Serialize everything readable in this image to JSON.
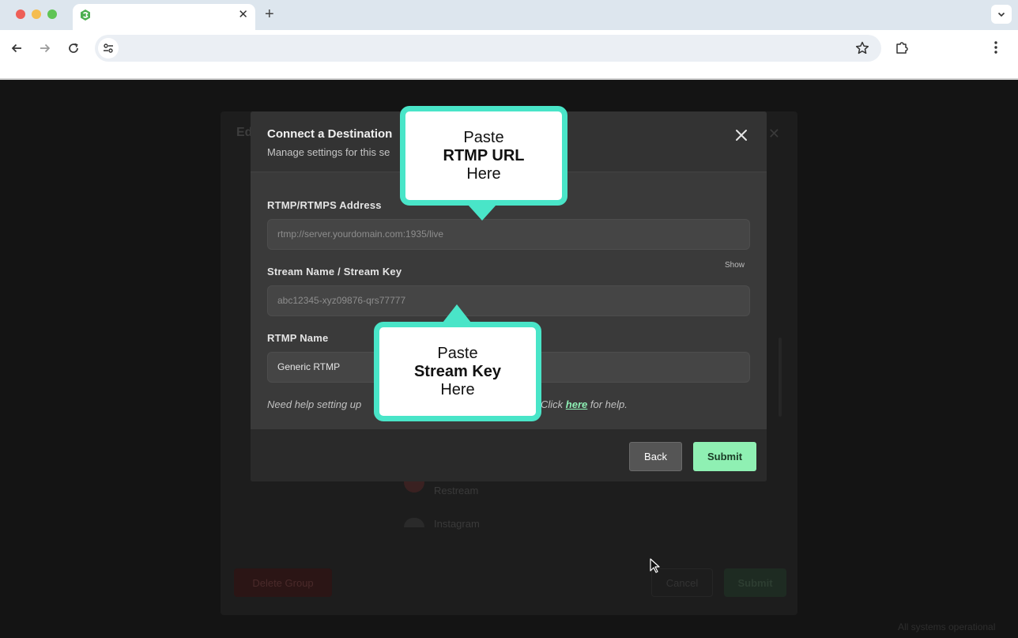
{
  "browser": {
    "tab_title": "",
    "tab_close": "✕",
    "new_tab": "+",
    "address": ""
  },
  "background": {
    "title": "Ed",
    "close": "✕",
    "item1": "Restream",
    "item2": "Instagram",
    "delete_button": "Delete Group",
    "cancel_button": "Cancel",
    "submit_button": "Submit",
    "footer": "All systems operational"
  },
  "modal": {
    "title": "Connect a Destination",
    "subtitle": "Manage settings for this se",
    "rtmp_label": "RTMP/RTMPS Address",
    "rtmp_placeholder": "rtmp://server.yourdomain.com:1935/live",
    "key_label": "Stream Name / Stream Key",
    "key_placeholder": "abc12345-xyz09876-qrs77777",
    "show_link": "Show",
    "name_label": "RTMP Name",
    "name_value": "Generic RTMP",
    "help_left": "Need help setting up",
    "help_click": "Click",
    "help_link": "here",
    "help_tail": "for help.",
    "back_button": "Back",
    "submit_button": "Submit"
  },
  "callouts": {
    "rtmp": {
      "line1": "Paste",
      "line2": "RTMP URL",
      "line3": "Here"
    },
    "key": {
      "line1": "Paste",
      "line2": "Stream Key",
      "line3": "Here"
    }
  },
  "colors": {
    "accent": "#49e5c8",
    "submit": "#8ff0b3",
    "help_link": "#8ef0b5"
  }
}
